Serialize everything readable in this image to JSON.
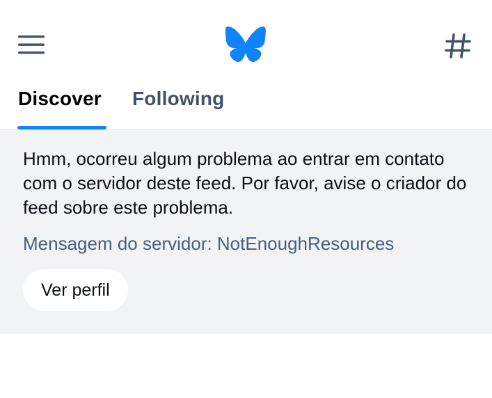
{
  "header": {
    "menu_icon": "hamburger-menu-icon",
    "logo_icon": "bluesky-butterfly-icon",
    "hash_icon": "hashtag-icon",
    "brand_color": "#1083fe"
  },
  "tabs": [
    {
      "label": "Discover",
      "active": true
    },
    {
      "label": "Following",
      "active": false
    }
  ],
  "error": {
    "message": "Hmm, ocorreu algum problema ao entrar em contato com o servidor deste feed. Por favor, avise o criador do feed sobre este problema.",
    "server_message": "Mensagem do servidor: NotEnoughResources",
    "button_label": "Ver perfil"
  }
}
